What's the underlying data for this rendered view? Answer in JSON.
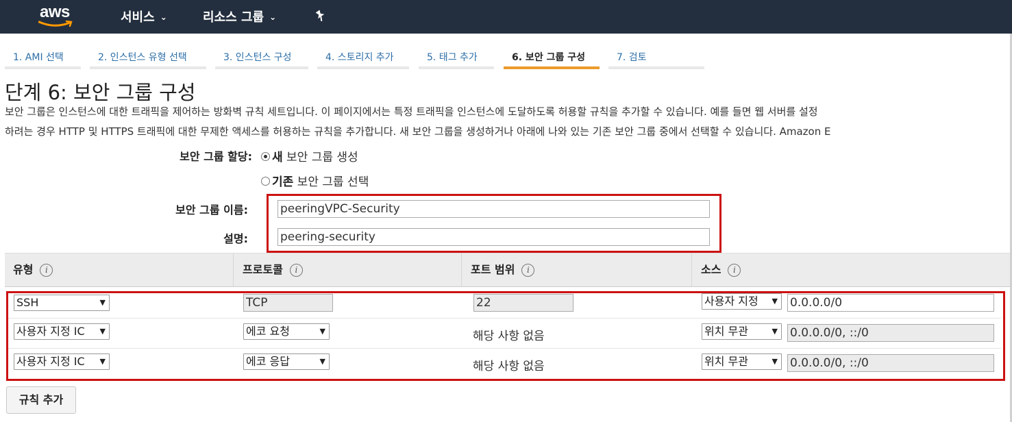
{
  "topbar": {
    "logo_text": "aws",
    "services_label": "서비스",
    "resource_groups_label": "리소스 그룹",
    "chevron_icon": "chevron-down-icon",
    "pin_icon": "pin-icon"
  },
  "steps": [
    {
      "label": "1. AMI 선택"
    },
    {
      "label": "2. 인스턴스 유형 선택"
    },
    {
      "label": "3. 인스턴스 구성"
    },
    {
      "label": "4. 스토리지 추가"
    },
    {
      "label": "5. 태그 추가"
    },
    {
      "label": "6. 보안 그룹 구성"
    },
    {
      "label": "7. 검토"
    }
  ],
  "active_step": 5,
  "page": {
    "title": "단계 6: 보안 그룹 구성",
    "desc_line1": "보안 그룹은 인스턴스에 대한 트래픽을 제어하는 방화벽 규칙 세트입니다. 이 페이지에서는 특정 트래픽을 인스턴스에 도달하도록 허용할 규칙을 추가할 수 있습니다. 예를 들면 웹 서버를 설정",
    "desc_line2": "하려는 경우 HTTP 및 HTTPS 트래픽에 대한 무제한 액세스를 허용하는 규칙을 추가합니다. 새 보안 그룹을 생성하거나 아래에 나와 있는 기존 보안 그룹 중에서 선택할 수 있습니다. Amazon E"
  },
  "form": {
    "assign_label": "보안 그룹 할당:",
    "new_option_bold": "새",
    "new_option_rest": " 보안 그룹 생성",
    "existing_option_bold": "기존",
    "existing_option_rest": " 보안 그룹 선택",
    "selected_option": "new",
    "name_label": "보안 그룹 이름:",
    "name_value": "peeringVPC-Security",
    "desc_label": "설명:",
    "desc_value": "peering-security"
  },
  "table": {
    "headers": [
      "유형",
      "프로토콜",
      "포트 범위",
      "소스"
    ],
    "info_glyph": "i",
    "rows": [
      {
        "type": "SSH",
        "protocol": "TCP",
        "port": "22",
        "source_select": "사용자 지정",
        "source_value": "0.0.0.0/0"
      },
      {
        "type": "사용자 지정 IC",
        "protocol": "에코 요청",
        "port": "해당 사항 없음",
        "source_select": "위치 무관",
        "source_value": "0.0.0.0/0, ::/0"
      },
      {
        "type": "사용자 지정 IC",
        "protocol": "에코 응답",
        "port": "해당 사항 없음",
        "source_select": "위치 무관",
        "source_value": "0.0.0.0/0, ::/0"
      }
    ]
  },
  "add_rule_label": "규칙 추가",
  "colors": {
    "topbar": "#232f3e",
    "link": "#2d6fa8",
    "active_tab": "#ec9a2c",
    "highlight_box": "#cc1111"
  }
}
